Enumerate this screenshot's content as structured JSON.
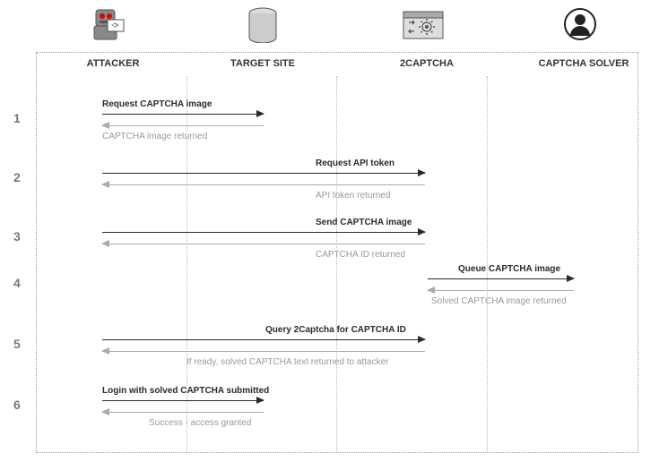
{
  "columns": {
    "attacker": "ATTACKER",
    "target": "TARGET SITE",
    "twocaptcha": "2CAPTCHA",
    "solver": "CAPTCHA SOLVER"
  },
  "icons": {
    "attacker": "robot-icon",
    "target": "database-icon",
    "twocaptcha": "service-icon",
    "solver": "person-icon"
  },
  "steps": [
    {
      "num": "1",
      "req": "Request CAPTCHA image",
      "resp": "CAPTCHA image returned"
    },
    {
      "num": "2",
      "req": "Request API token",
      "resp": "API token returned"
    },
    {
      "num": "3",
      "req": "Send CAPTCHA image",
      "resp": "CAPTCHA ID returned"
    },
    {
      "num": "4",
      "req": "Queue CAPTCHA image",
      "resp": "Solved CAPTCHA image returned"
    },
    {
      "num": "5",
      "req": "Query 2Captcha for CAPTCHA ID",
      "resp": "If ready, solved CAPTCHA text returned to attacker"
    },
    {
      "num": "6",
      "req": "Login with solved CAPTCHA submitted",
      "resp": "Success - access granted"
    }
  ]
}
